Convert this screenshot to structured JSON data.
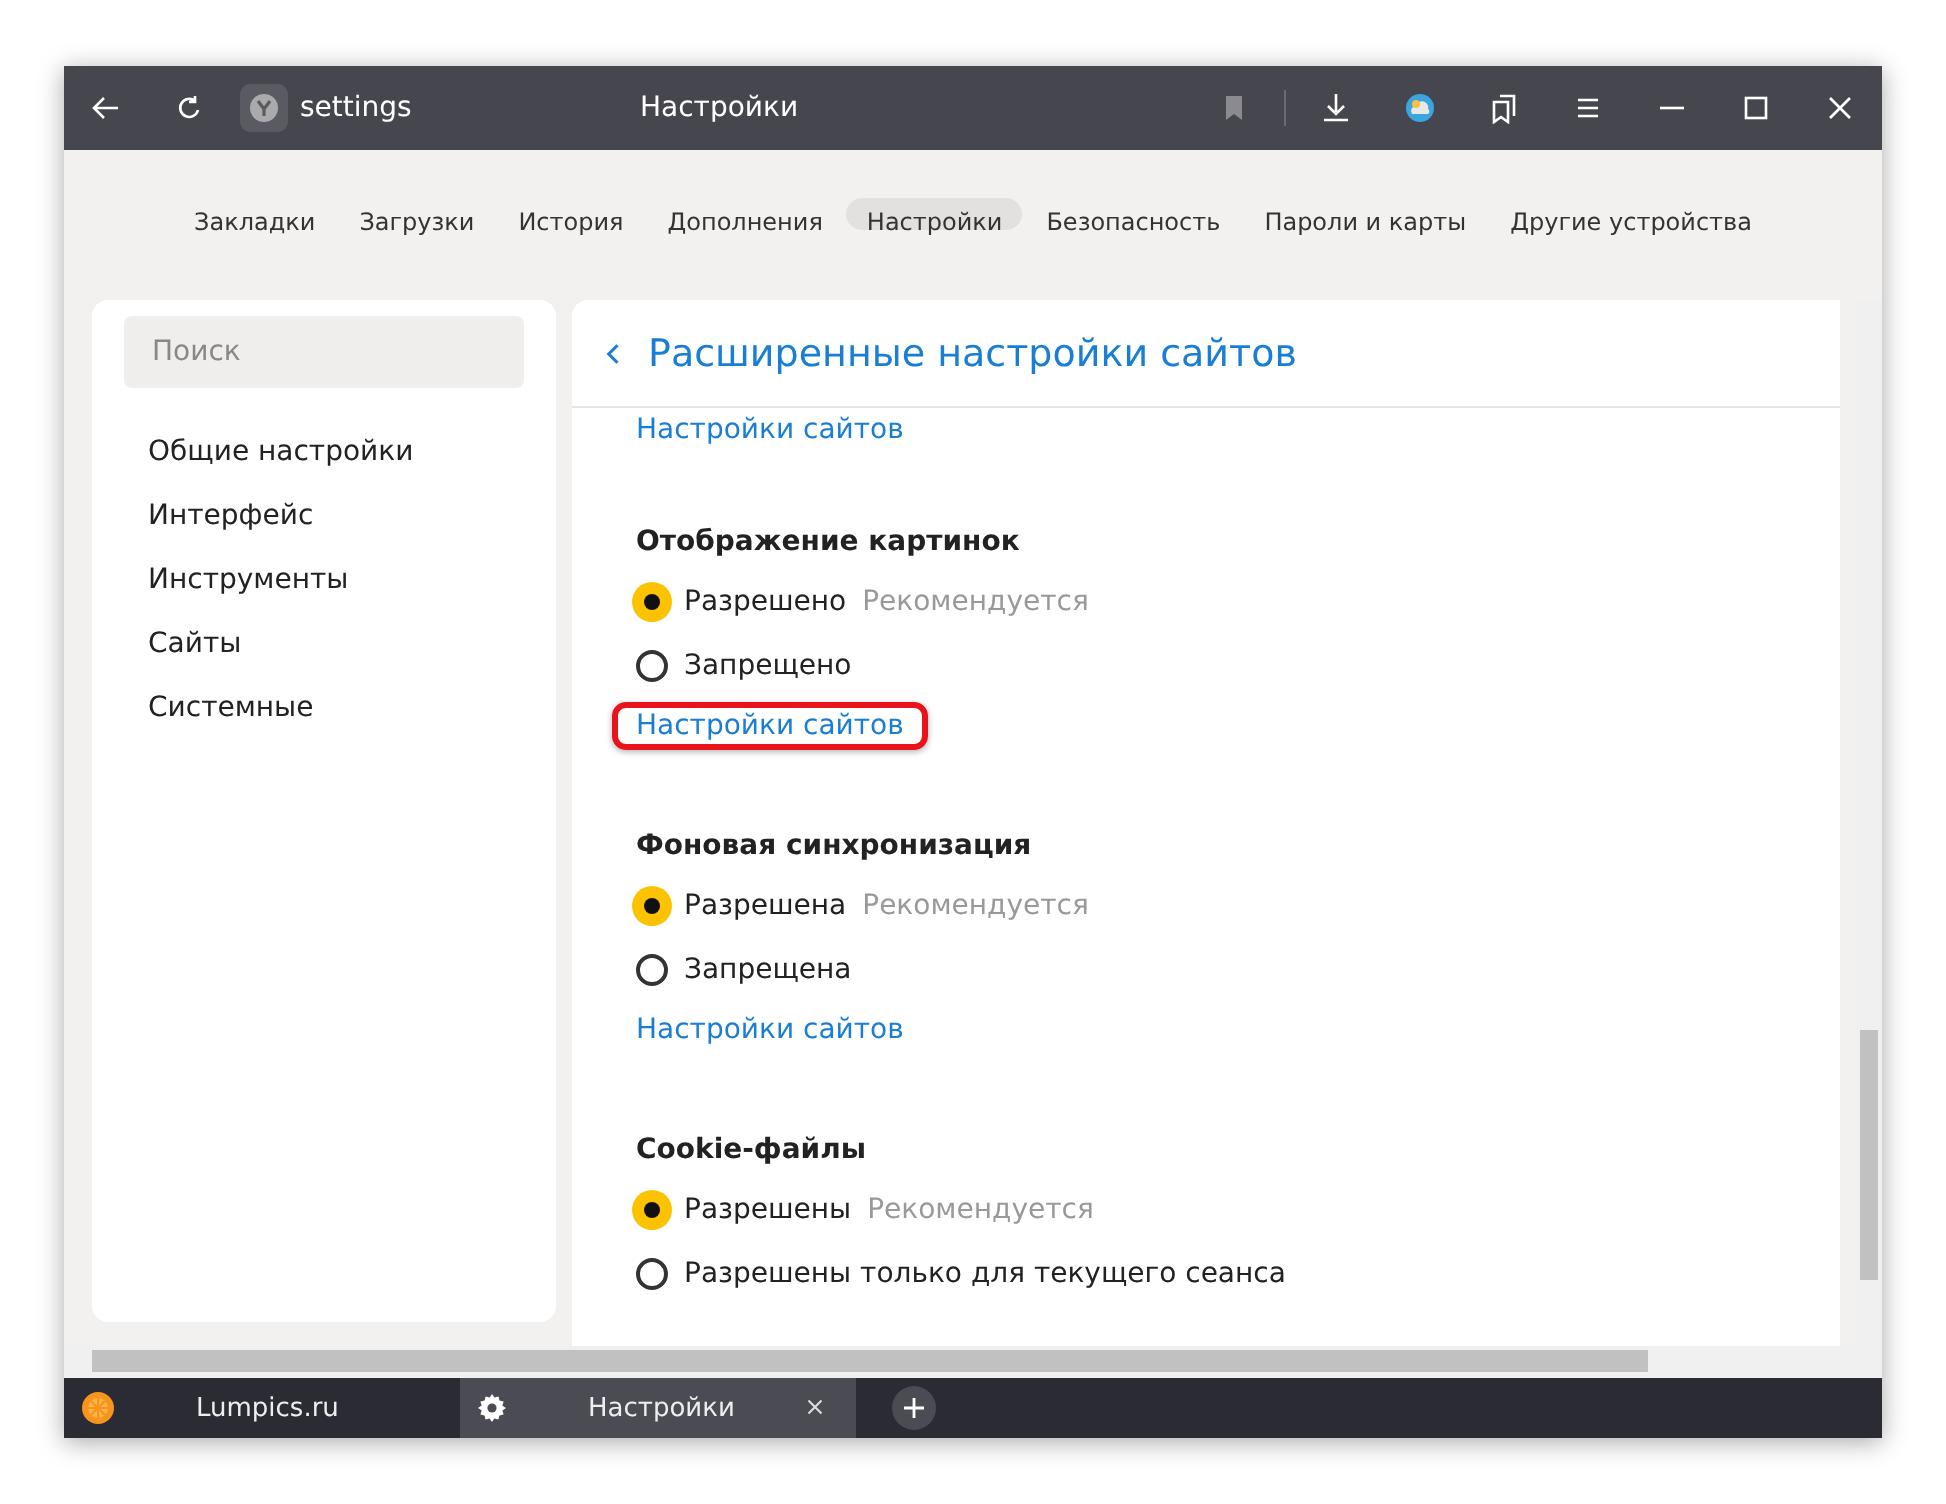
{
  "window": {
    "address": "settings",
    "title": "Настройки"
  },
  "nav_tabs": [
    {
      "label": "Закладки",
      "selected": false
    },
    {
      "label": "Загрузки",
      "selected": false
    },
    {
      "label": "История",
      "selected": false
    },
    {
      "label": "Дополнения",
      "selected": false
    },
    {
      "label": "Настройки",
      "selected": true
    },
    {
      "label": "Безопасность",
      "selected": false
    },
    {
      "label": "Пароли и карты",
      "selected": false
    },
    {
      "label": "Другие устройства",
      "selected": false
    }
  ],
  "sidebar": {
    "search": {
      "placeholder": "Поиск"
    },
    "items": [
      "Общие настройки",
      "Интерфейс",
      "Инструменты",
      "Сайты",
      "Системные"
    ]
  },
  "panel": {
    "title": "Расширенные настройки сайтов",
    "top_link": "Настройки сайтов",
    "sections": [
      {
        "title": "Отображение картинок",
        "options": [
          {
            "label": "Разрешено",
            "note": "Рекомендуется",
            "selected": true
          },
          {
            "label": "Запрещено",
            "selected": false
          }
        ],
        "link": {
          "text": "Настройки сайтов",
          "highlighted": true
        }
      },
      {
        "title": "Фоновая синхронизация",
        "options": [
          {
            "label": "Разрешена",
            "note": "Рекомендуется",
            "selected": true
          },
          {
            "label": "Запрещена",
            "selected": false
          }
        ],
        "link": {
          "text": "Настройки сайтов",
          "highlighted": false
        }
      },
      {
        "title": "Cookie-файлы",
        "options": [
          {
            "label": "Разрешены",
            "note": "Рекомендуется",
            "selected": true
          },
          {
            "label": "Разрешены только для текущего сеанса",
            "selected": false
          }
        ]
      }
    ]
  },
  "browser_tabs": [
    {
      "title": "Lumpics.ru",
      "kind": "site",
      "selected": false
    },
    {
      "title": "Настройки",
      "kind": "settings",
      "selected": true
    }
  ]
}
